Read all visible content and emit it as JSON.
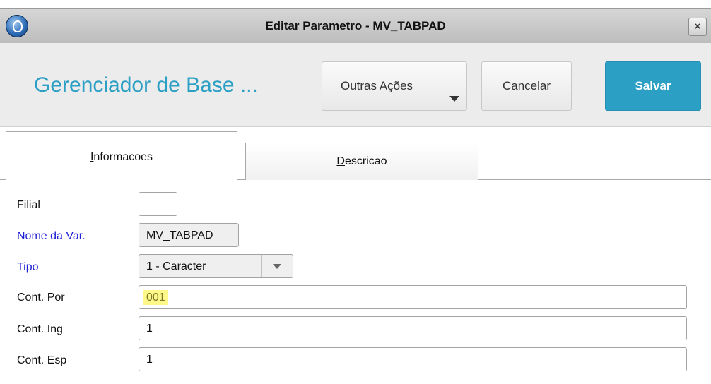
{
  "window": {
    "title": "Editar Parametro - MV_TABPAD",
    "close_label": "×"
  },
  "header": {
    "app_title": "Gerenciador de Base ...",
    "buttons": {
      "outras": "Outras Ações",
      "cancel": "Cancelar",
      "save": "Salvar"
    }
  },
  "tabs": [
    {
      "label_first": "I",
      "label_rest": "nformacoes"
    },
    {
      "label_first": "D",
      "label_rest": "escricao"
    }
  ],
  "form": {
    "filial": {
      "label": "Filial",
      "value": ""
    },
    "nome": {
      "label": "Nome da Var.",
      "value": "MV_TABPAD"
    },
    "tipo": {
      "label": "Tipo",
      "value": "1 - Caracter"
    },
    "cont_por": {
      "label": "Cont. Por",
      "value": "001"
    },
    "cont_ing": {
      "label": "Cont. Ing",
      "value": "1"
    },
    "cont_esp": {
      "label": "Cont. Esp",
      "value": "1"
    }
  },
  "colors": {
    "accent": "#2b9fc4",
    "required_label": "#1f1fd6",
    "highlight": "#fff98a"
  },
  "icons": {
    "app": "protheus-logo-icon",
    "close": "close-icon",
    "dropdown": "chevron-down-icon"
  }
}
